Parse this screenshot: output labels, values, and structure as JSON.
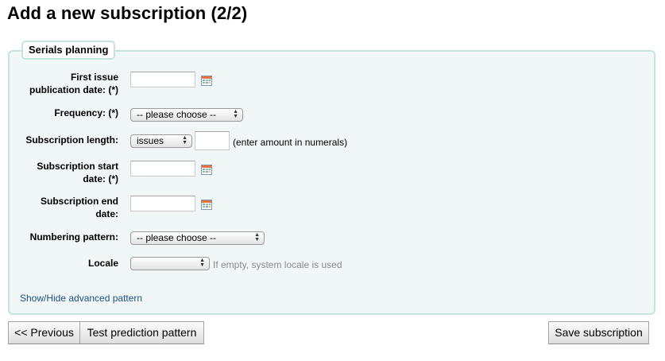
{
  "page_title": "Add a new subscription (2/2)",
  "fieldset": {
    "legend": "Serials planning",
    "fields": {
      "first_issue": {
        "label_line1": "First issue",
        "label_line2": "publication date: (*)",
        "value": ""
      },
      "frequency": {
        "label": "Frequency: (*)",
        "selected": "-- please choose --"
      },
      "subscription_length": {
        "label": "Subscription length:",
        "unit_selected": "issues",
        "value": "",
        "hint": "(enter amount in numerals)"
      },
      "start_date": {
        "label_line1": "Subscription start",
        "label_line2": "date: (*)",
        "value": ""
      },
      "end_date": {
        "label_line1": "Subscription end",
        "label_line2": "date:",
        "value": ""
      },
      "numbering_pattern": {
        "label": "Numbering pattern:",
        "selected": "-- please choose --"
      },
      "locale": {
        "label": "Locale",
        "selected": "",
        "hint": "If empty, system locale is used"
      }
    },
    "advanced_link": "Show/Hide advanced pattern"
  },
  "buttons": {
    "previous": "<< Previous",
    "test_prediction": "Test prediction pattern",
    "save": "Save subscription"
  },
  "icons": {
    "date_picker": "calendar-icon",
    "select_arrows": "updown-arrows-icon"
  },
  "colors": {
    "fieldset_background": "#f1f7f6",
    "fieldset_border": "#c5e4df",
    "link": "#1a4f8b",
    "hint_muted": "#8a8a8a"
  }
}
